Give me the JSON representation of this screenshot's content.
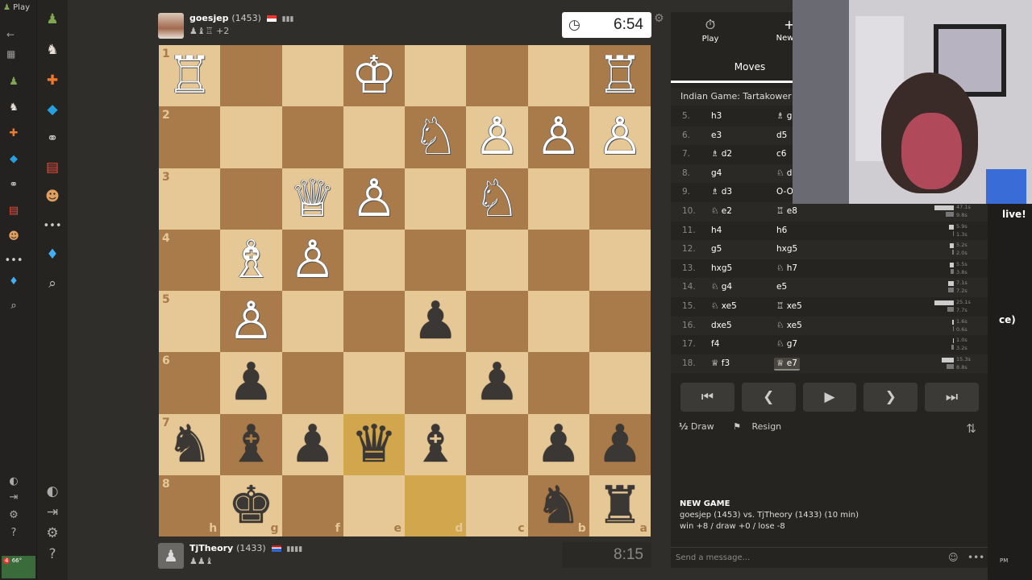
{
  "browser": {
    "tab_label": "Play",
    "bottom_left_badge": "4",
    "bottom_left_text": "66°",
    "bottom_right_text": "PM"
  },
  "top_player": {
    "name": "goesjep",
    "rating": "(1453)",
    "captures": "+2",
    "clock": "6:54"
  },
  "bottom_player": {
    "name": "TjTheory",
    "rating": "(1433)",
    "clock": "8:15"
  },
  "board": {
    "ranks": [
      "1",
      "2",
      "3",
      "4",
      "5",
      "6",
      "7",
      "8"
    ],
    "files": [
      "h",
      "g",
      "f",
      "e",
      "d",
      "c",
      "b",
      "a"
    ],
    "rows": [
      [
        "wR",
        "",
        "",
        "wK",
        "",
        "",
        "",
        "wR"
      ],
      [
        "",
        "",
        "",
        "",
        "wN",
        "wP",
        "wP",
        "wP"
      ],
      [
        "",
        "",
        "wQ",
        "wP",
        "",
        "wN",
        "",
        ""
      ],
      [
        "",
        "wB",
        "wP",
        "",
        "",
        "",
        "",
        ""
      ],
      [
        "",
        "wP",
        "",
        "",
        "bP",
        "",
        "",
        ""
      ],
      [
        "",
        "bP",
        "",
        "",
        "",
        "bP",
        "",
        ""
      ],
      [
        "bN",
        "bB",
        "bP",
        "bQ",
        "bB",
        "",
        "bP",
        "bP"
      ],
      [
        "",
        "bK",
        "",
        "",
        "",
        "",
        "bN",
        "bR"
      ]
    ],
    "highlighted": [
      "6-3",
      "7-4"
    ]
  },
  "panel": {
    "tab_play": "Play",
    "tab_new_game": "New G",
    "moves_tab": "Moves",
    "opening": "Indian Game: Tartakower Defer",
    "moves": [
      {
        "n": "5.",
        "w": "h3",
        "b": "♗ g7"
      },
      {
        "n": "6.",
        "w": "e3",
        "b": "d5"
      },
      {
        "n": "7.",
        "w": "♗ d2",
        "b": "c6"
      },
      {
        "n": "8.",
        "w": "g4",
        "b": "♘ d7"
      },
      {
        "n": "9.",
        "w": "♗ d3",
        "b": "O-O"
      },
      {
        "n": "10.",
        "w": "♘ e2",
        "b": "♖ e8"
      },
      {
        "n": "11.",
        "w": "h4",
        "b": "h6"
      },
      {
        "n": "12.",
        "w": "g5",
        "b": "hxg5"
      },
      {
        "n": "13.",
        "w": "hxg5",
        "b": "♘ h7"
      },
      {
        "n": "14.",
        "w": "♘ g4",
        "b": "e5"
      },
      {
        "n": "15.",
        "w": "♘ xe5",
        "b": "♖ xe5"
      },
      {
        "n": "16.",
        "w": "dxe5",
        "b": "♘ xe5"
      },
      {
        "n": "17.",
        "w": "f4",
        "b": "♘ g7"
      },
      {
        "n": "18.",
        "w": "♕ f3",
        "b": "♕ e7"
      }
    ],
    "times": [
      [
        "",
        ""
      ],
      [
        "",
        ""
      ],
      [
        "",
        ""
      ],
      [
        "",
        ""
      ],
      [
        "",
        ""
      ],
      [
        "47.1s",
        "9.8s"
      ],
      [
        "5.9s",
        "1.3s"
      ],
      [
        "5.2s",
        "2.0s"
      ],
      [
        "5.5s",
        "3.8s"
      ],
      [
        "7.1s",
        "7.2s"
      ],
      [
        "25.1s",
        "7.7s"
      ],
      [
        "1.6s",
        "0.6s"
      ],
      [
        "1.0s",
        "3.2s"
      ],
      [
        "15.3s",
        "8.8s"
      ]
    ],
    "draw_label": "Draw",
    "resign_label": "Resign",
    "new_game_title": "NEW GAME",
    "new_game_line1": "goesjep (1453) vs. TjTheory (1433) (10 min)",
    "new_game_line2": "win +8 / draw +0 / lose -8",
    "chat_placeholder": "Send a message..."
  },
  "stream": {
    "live_text": "live!",
    "side_text": "ce)"
  },
  "colors": {
    "light_square": "#e6c796",
    "dark_square": "#a97a4a",
    "highlight": "#d2a64c",
    "panel_bg": "#262421",
    "page_bg": "#302e2b"
  }
}
